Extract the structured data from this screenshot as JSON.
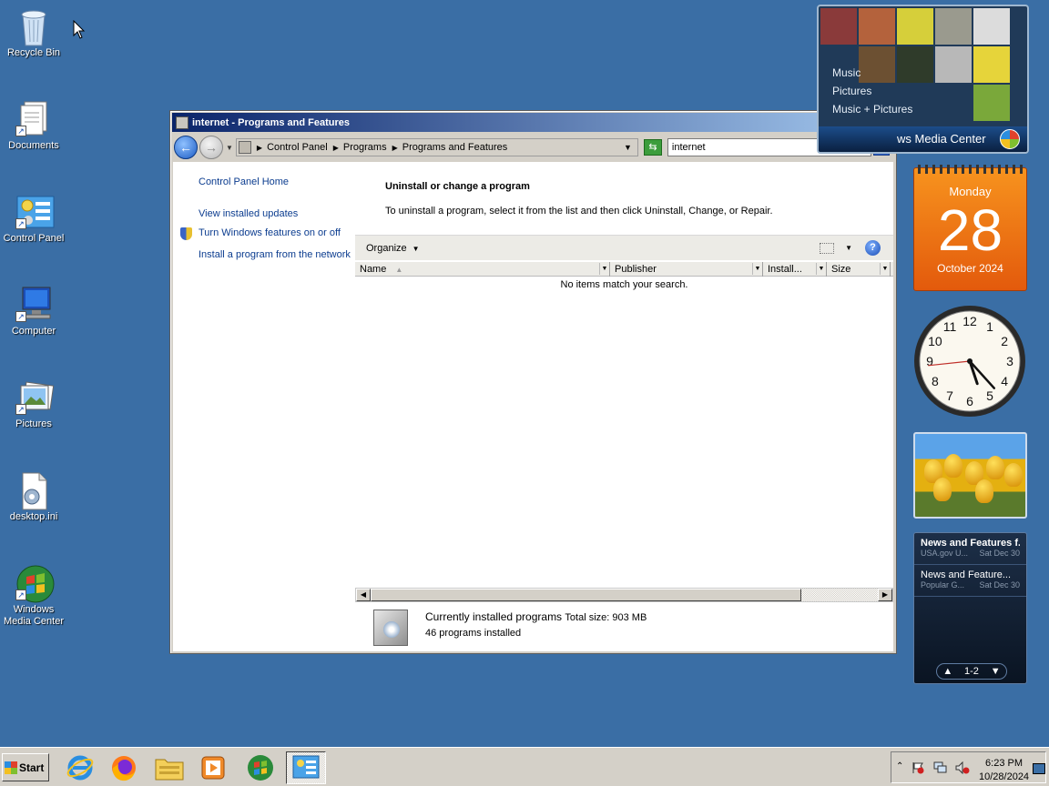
{
  "desktop": {
    "icons": [
      {
        "label": "Recycle Bin"
      },
      {
        "label": "Documents"
      },
      {
        "label": "Control Panel"
      },
      {
        "label": "Computer"
      },
      {
        "label": "Pictures"
      },
      {
        "label": "desktop.ini"
      },
      {
        "label": "Windows Media Center"
      }
    ]
  },
  "window": {
    "title": "internet - Programs and Features",
    "buttons": {
      "minimize": "_",
      "maximize": "□",
      "close": "✕"
    },
    "breadcrumb": [
      "Control Panel",
      "Programs",
      "Programs and Features"
    ],
    "search_value": "internet",
    "left_links": {
      "home": "Control Panel Home",
      "updates": "View installed updates",
      "features": "Turn Windows features on or off",
      "network": "Install a program from the network"
    },
    "heading": "Uninstall or change a program",
    "subtext": "To uninstall a program, select it from the list and then click Uninstall, Change, or Repair.",
    "toolbar": {
      "organize": "Organize"
    },
    "columns": [
      "Name",
      "Publisher",
      "Install...",
      "Size"
    ],
    "empty_message": "No items match your search.",
    "details": {
      "label": "Currently installed programs",
      "total_size": "Total size: 903 MB",
      "count": "46 programs installed"
    }
  },
  "gadgets": {
    "media_center": {
      "menu": [
        "Music",
        "Pictures",
        "Music + Pictures"
      ],
      "bar_title": "ws Media Center"
    },
    "calendar": {
      "weekday": "Monday",
      "day": "28",
      "month_year": "October 2024"
    },
    "clock": {
      "hour": 5,
      "minute": 23,
      "second": 44
    },
    "feeds": {
      "items": [
        {
          "title": "News and Features f...",
          "source": "USA.gov U...",
          "date": "Sat Dec 30"
        },
        {
          "title": "News and Feature...",
          "source": "Popular G...",
          "date": "Sat Dec 30"
        }
      ],
      "pager": "1-2"
    }
  },
  "taskbar": {
    "start_label": "Start",
    "time": "6:23 PM",
    "date": "10/28/2024"
  }
}
